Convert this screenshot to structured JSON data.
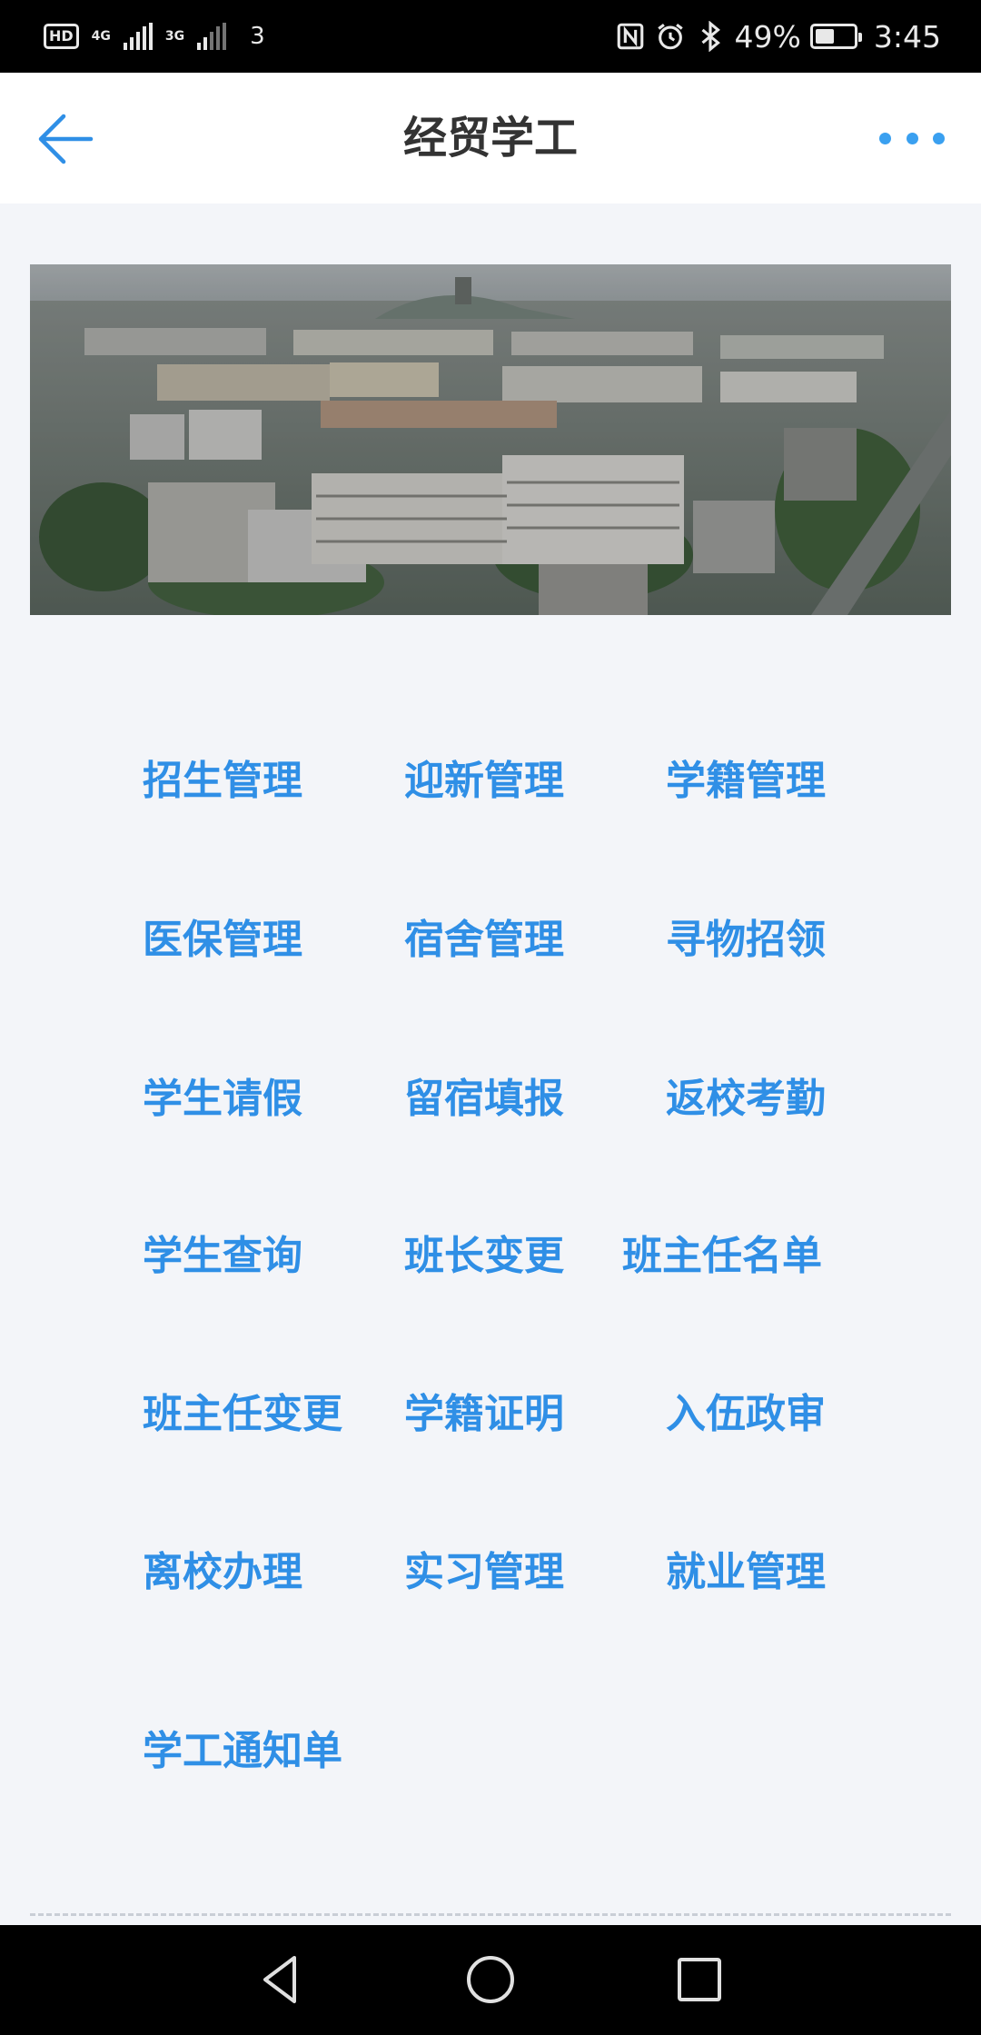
{
  "status_bar": {
    "hd": "HD",
    "net1": "4G",
    "net2": "3G",
    "sim": "3",
    "battery_pct": "49%",
    "battery_level": 0.49,
    "time": "3:45",
    "icons": [
      "nfc-icon",
      "alarm-icon",
      "bluetooth-icon",
      "battery-icon"
    ]
  },
  "header": {
    "title": "经贸学工",
    "back_icon": "arrow-left-icon",
    "more_icon": "more-horizontal-icon"
  },
  "menu": {
    "items": [
      {
        "label": "招生管理"
      },
      {
        "label": "迎新管理"
      },
      {
        "label": "学籍管理"
      },
      {
        "label": "医保管理"
      },
      {
        "label": "宿舍管理"
      },
      {
        "label": "寻物招领"
      },
      {
        "label": "学生请假"
      },
      {
        "label": "留宿填报"
      },
      {
        "label": "返校考勤"
      },
      {
        "label": "学生查询"
      },
      {
        "label": "班长变更"
      },
      {
        "label": "班主任名单"
      },
      {
        "label": "班主任变更"
      },
      {
        "label": "学籍证明"
      },
      {
        "label": "入伍政审"
      },
      {
        "label": "离校办理"
      },
      {
        "label": "实习管理"
      },
      {
        "label": "就业管理"
      },
      {
        "label": "学工通知单"
      }
    ]
  },
  "nav_bar": {
    "icons": [
      "back-triangle-icon",
      "home-circle-icon",
      "recents-square-icon"
    ]
  },
  "colors": {
    "accent": "#2f8fe6",
    "title": "#333333",
    "background": "#f3f5f9"
  }
}
